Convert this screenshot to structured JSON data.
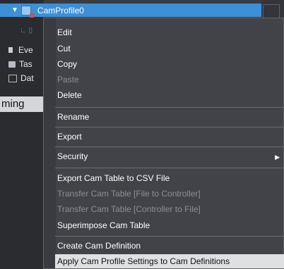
{
  "tree": {
    "selected_item": "CamProfile0",
    "items": [
      "Eve",
      "Tas",
      "Dat"
    ]
  },
  "tab": {
    "label": "ming"
  },
  "context_menu": {
    "items": [
      {
        "label": "Edit",
        "disabled": false
      },
      {
        "label": "Cut",
        "disabled": false
      },
      {
        "label": "Copy",
        "disabled": false
      },
      {
        "label": "Paste",
        "disabled": true
      },
      {
        "label": "Delete",
        "disabled": false
      },
      {
        "label": "Rename",
        "disabled": false
      },
      {
        "label": "Export",
        "disabled": false
      },
      {
        "label": "Security",
        "disabled": false,
        "has_submenu": true
      },
      {
        "label": "Export Cam Table to CSV File",
        "disabled": false
      },
      {
        "label": "Transfer Cam Table [File to Controller]",
        "disabled": true
      },
      {
        "label": "Transfer Cam Table [Controller to File]",
        "disabled": true
      },
      {
        "label": "Superimpose Cam Table",
        "disabled": false
      },
      {
        "label": "Create Cam Definition",
        "disabled": false
      },
      {
        "label": "Apply Cam Profile Settings to Cam Definitions",
        "disabled": false,
        "highlighted": true
      }
    ]
  },
  "colors": {
    "selection": "#3d8fd6",
    "menu_bg": "#414349",
    "hover_bg": "#dfe0e2"
  }
}
